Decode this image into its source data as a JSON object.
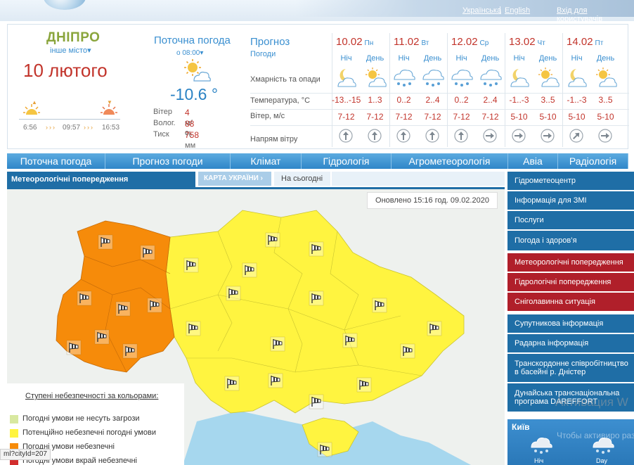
{
  "header": {
    "lang_ua": "Українська",
    "lang_en": "English",
    "login": "Вхід для користувачів"
  },
  "location": {
    "city": "ДНІПРО",
    "other_city": "інше місто",
    "date": "10 лютого",
    "sunrise": "6:56",
    "noon": "09:57",
    "sunset": "16:53"
  },
  "current": {
    "title": "Поточна погода",
    "time": "о 08:00",
    "temp": "-10.6 °",
    "wind_label": "Вітер",
    "wind_value": "4",
    "wind_unit": "м/с",
    "humidity_label": "Волог.",
    "humidity_value": "88",
    "humidity_unit": "%",
    "pressure_label": "Тиск",
    "pressure_value": "758",
    "pressure_unit": "мм рт. ст.",
    "icon": "sun-cloud-icon"
  },
  "forecast": {
    "title": "Прогноз",
    "subtitle": "Погоди",
    "row_labels": {
      "cloud": "Хмарність та опади",
      "temp": "Температура, °С",
      "wind": "Вітер, м/с",
      "direction": "Напрям вітру"
    },
    "night_label": "Ніч",
    "day_label": "День",
    "days": [
      {
        "date": "10.02",
        "dow": "Пн",
        "night": {
          "icon": "moon-cloud-icon",
          "temp": "-13..-15",
          "wind": "7-12",
          "dir_deg": 0
        },
        "day": {
          "icon": "sun-cloud-icon",
          "temp": "1..3",
          "wind": "7-12",
          "dir_deg": 0
        }
      },
      {
        "date": "11.02",
        "dow": "Вт",
        "night": {
          "icon": "cloud-snow-icon",
          "temp": "0..2",
          "wind": "7-12",
          "dir_deg": 0
        },
        "day": {
          "icon": "cloud-snow-icon",
          "temp": "2..4",
          "wind": "7-12",
          "dir_deg": 0
        }
      },
      {
        "date": "12.02",
        "dow": "Ср",
        "night": {
          "icon": "cloud-snow-icon",
          "temp": "0..2",
          "wind": "7-12",
          "dir_deg": 0
        },
        "day": {
          "icon": "cloud-snow-icon",
          "temp": "2..4",
          "wind": "7-12",
          "dir_deg": 90
        }
      },
      {
        "date": "13.02",
        "dow": "Чт",
        "night": {
          "icon": "moon-cloud-icon",
          "temp": "-1..-3",
          "wind": "5-10",
          "dir_deg": 90
        },
        "day": {
          "icon": "sun-cloud-icon",
          "temp": "3..5",
          "wind": "5-10",
          "dir_deg": 90
        }
      },
      {
        "date": "14.02",
        "dow": "Пт",
        "night": {
          "icon": "moon-cloud-icon",
          "temp": "-1..-3",
          "wind": "5-10",
          "dir_deg": 45
        },
        "day": {
          "icon": "sun-cloud-icon",
          "temp": "3..5",
          "wind": "5-10",
          "dir_deg": 90
        }
      }
    ]
  },
  "nav": [
    "Поточна погода",
    "Прогноз погоди",
    "Клімат",
    "Гідрологія",
    "Агрометеорологія",
    "Авіа",
    "Радіологія"
  ],
  "tabs": {
    "active": "Метеорологічні попередження",
    "map": "КАРТА УКРАЇНИ",
    "today": "На сьогодні"
  },
  "map": {
    "updated": "Оновлено 15:16 год. 09.02.2020",
    "colors": {
      "orange": "#f68b0a",
      "yellow": "#fff440",
      "green": "#d8e8a0",
      "sea": "#9fd3ea"
    }
  },
  "legend": {
    "title": "Ступені небезпечності за кольорами:",
    "items": [
      {
        "color": "#d8e8a0",
        "label": "Погодні умови не несуть загрози"
      },
      {
        "color": "#fff440",
        "label": "Потенційно небезпечні погодні умови"
      },
      {
        "color": "#f68b0a",
        "label": "Погодні умови небезпечні"
      },
      {
        "color": "#d22e2e",
        "label": "Погодні умови вкрай небезпечні"
      }
    ]
  },
  "status_url": "ml?cityId=207",
  "sidebar": [
    {
      "label": "Гідрометеоцентр",
      "style": "blue"
    },
    {
      "label": "Інформація для ЗМІ",
      "style": "blue"
    },
    {
      "label": "Послуги",
      "style": "blue"
    },
    {
      "label": "Погода і здоров’я",
      "style": "blue"
    },
    {
      "label": "Метеорологічні попередження",
      "style": "red"
    },
    {
      "label": "Гідрологічні попередження",
      "style": "red"
    },
    {
      "label": "Сніголавинна ситуація",
      "style": "red"
    },
    {
      "label": "Супутникова інформація",
      "style": "blue"
    },
    {
      "label": "Радарна інформація",
      "style": "blue"
    },
    {
      "label": "Транскордонне співробітництво в басейні р. Дністер",
      "style": "blue"
    },
    {
      "label": "Дунайська транснаціональна програма DAREFFORT",
      "style": "blue"
    }
  ],
  "kyiv": {
    "name": "Київ",
    "overlay1": "Активация W",
    "overlay2": "Чтобы активиро раздел \"Параме",
    "night": "Ніч",
    "day": "Day"
  }
}
